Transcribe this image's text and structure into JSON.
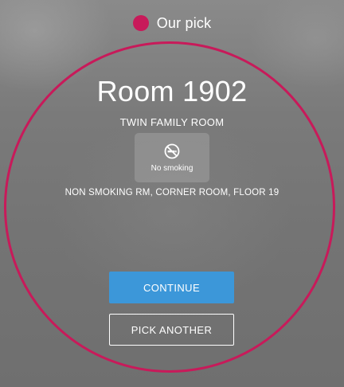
{
  "header": {
    "pick_label": "Our pick",
    "pick_dot_color": "#c81a5a"
  },
  "room": {
    "title": "Room 1902",
    "type": "TWIN FAMILY ROOM",
    "description": "NON SMOKING RM, CORNER ROOM, FLOOR 19"
  },
  "amenity": {
    "icon": "no-smoking-icon",
    "label": "No smoking"
  },
  "actions": {
    "continue_label": "CONTINUE",
    "continue_color": "#3c97d9",
    "pick_another_label": "PICK ANOTHER"
  },
  "accent_color": "#c81a5a"
}
